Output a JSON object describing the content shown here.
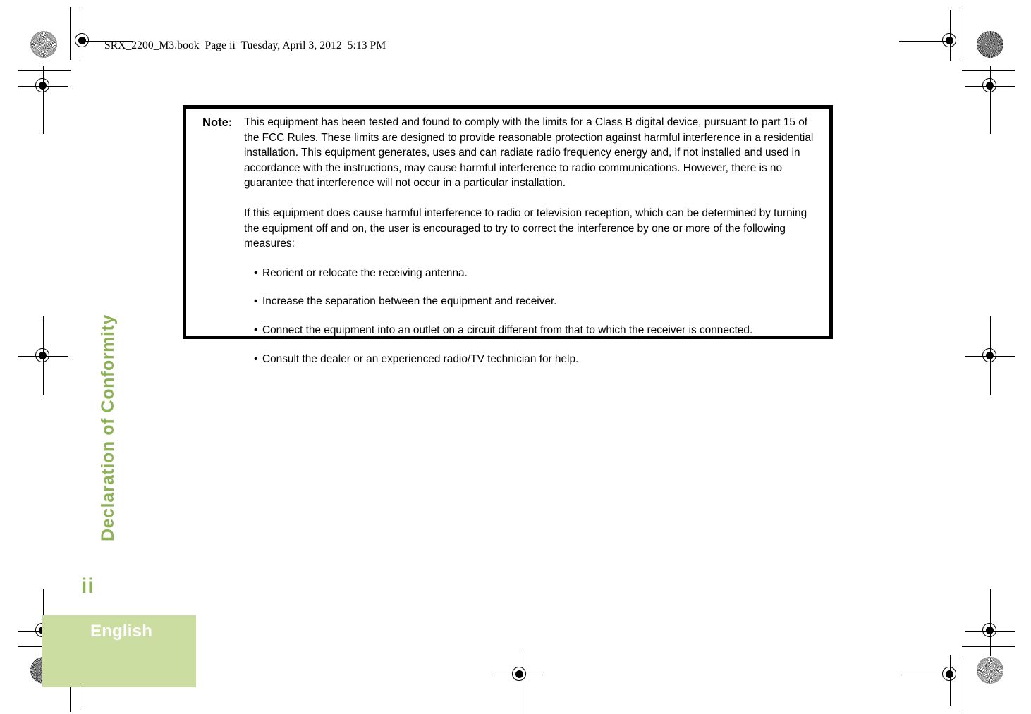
{
  "header": {
    "slug": "SRX_2200_M3.book  Page ii  Tuesday, April 3, 2012  5:13 PM"
  },
  "note_box": {
    "label": "Note:",
    "paragraphs": [
      "This equipment has been tested and found to comply with the limits for a Class B digital device, pursuant to part 15 of the FCC Rules. These limits are designed to provide reasonable protection against harmful interference in a residential installation. This equipment generates, uses and can radiate radio frequency energy and, if not installed and used in accordance with the instructions, may cause harmful interference to radio communications. However, there is no guarantee that interference will not occur in a particular installation.",
      "If this equipment does cause harmful interference to radio or television reception, which can be determined by turning the equipment off and on, the user is encouraged to try to correct the interference by one or more of the following measures:"
    ],
    "bullet_marker": "•",
    "bullets": [
      "Reorient or relocate the receiving antenna.",
      "Increase the separation between the equipment and receiver.",
      "Connect the equipment into an outlet on a circuit different from that to which the receiver is connected.",
      "Consult the dealer or an experienced radio/TV technician for help."
    ]
  },
  "side_tab": {
    "title": "Declaration of Conformity"
  },
  "footer": {
    "page_number": "ii",
    "language": "English"
  },
  "colors": {
    "accent_green": "#8cb255",
    "band_green": "#cbdda0",
    "text_black": "#000000",
    "language_label": "#ffffff"
  }
}
